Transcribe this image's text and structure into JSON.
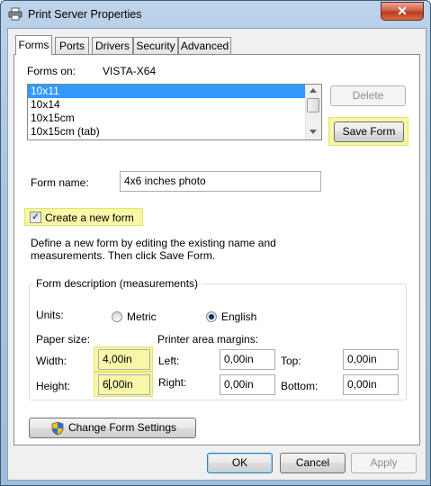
{
  "window": {
    "title": "Print Server Properties",
    "close_glyph": "✕",
    "title_icon": "printer-icon"
  },
  "tabs": [
    {
      "label": "Forms",
      "active": true
    },
    {
      "label": "Ports",
      "active": false
    },
    {
      "label": "Drivers",
      "active": false
    },
    {
      "label": "Security",
      "active": false
    },
    {
      "label": "Advanced",
      "active": false
    }
  ],
  "forms": {
    "forms_on_label": "Forms on:",
    "server_name": "VISTA-X64",
    "list": [
      "10x11",
      "10x14",
      "10x15cm",
      "10x15cm (tab)"
    ],
    "selected_index": 0,
    "delete_label": "Delete",
    "save_label": "Save Form",
    "form_name_label": "Form name:",
    "form_name_value": "4x6 inches photo",
    "create_new_label": "Create a new form",
    "create_new_checked": true,
    "instructions_line1": "Define a new form by editing the existing name and",
    "instructions_line2": "measurements. Then click Save Form.",
    "group_title": "Form description (measurements)",
    "units_label": "Units:",
    "metric_label": "Metric",
    "english_label": "English",
    "units_selected": "English",
    "paper_size_label": "Paper size:",
    "margins_label": "Printer area margins:",
    "width_label": "Width:",
    "width_value": "4,00in",
    "height_label": "Height:",
    "height_value_a": "6",
    "height_value_b": ",00in",
    "left_label": "Left:",
    "left_value": "0,00in",
    "top_label": "Top:",
    "top_value": "0,00in",
    "right_label": "Right:",
    "right_value": "0,00in",
    "bottom_label": "Bottom:",
    "bottom_value": "0,00in",
    "change_settings_label": "Change Form Settings",
    "check_glyph": "✓"
  },
  "footer": {
    "ok_label": "OK",
    "cancel_label": "Cancel",
    "apply_label": "Apply"
  },
  "colors": {
    "highlight": "#f7f7a8",
    "selection": "#3399ff",
    "ok_border": "#3c7fb1"
  }
}
